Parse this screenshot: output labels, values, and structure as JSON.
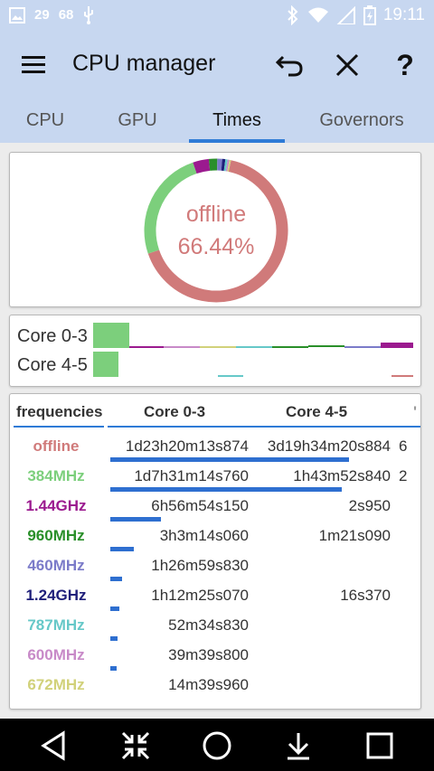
{
  "status_bar": {
    "left_icons": [
      "image-icon",
      "calendar-icon",
      "calendar-icon",
      "usb-icon"
    ],
    "left_texts": [
      "29",
      "68"
    ],
    "time": "19:11"
  },
  "app_bar": {
    "title": "CPU manager"
  },
  "tabs": [
    {
      "label": "CPU"
    },
    {
      "label": "GPU"
    },
    {
      "label": "Times",
      "active": true
    },
    {
      "label": "Governors"
    }
  ],
  "donut": {
    "center_label": "offline",
    "center_percent": "66.44%",
    "segments_pct": [
      66.44,
      25.0,
      3.6,
      1.9,
      1.1,
      0.7,
      0.5,
      0.4,
      0.36
    ],
    "segment_colors": [
      "#d07a7a",
      "#7ccf7c",
      "#9b1a8f",
      "#2a8f2a",
      "#7b7bc9",
      "#1f1f7a",
      "#66c8c8",
      "#c88ac8",
      "#d1d17a"
    ]
  },
  "core_bars": {
    "groups": [
      {
        "label": "Core 0-3"
      },
      {
        "label": "Core 4-5"
      }
    ]
  },
  "freq_table": {
    "headers": [
      "frequencies",
      "Core 0-3",
      "Core 4-5"
    ],
    "rows": [
      {
        "freq": "offline",
        "color": "#d07a7a",
        "core03": "1d23h20m13s874",
        "core45": "3d19h34m20s884",
        "overflow": "6",
        "bar_fraction": 0.66
      },
      {
        "freq": "384MHz",
        "color": "#7ccf7c",
        "core03": "1d7h31m14s760",
        "core45": "1h43m52s840",
        "overflow": "2",
        "bar_fraction": 0.64
      },
      {
        "freq": "1.44GHz",
        "color": "#9b1a8f",
        "core03": "6h56m54s150",
        "core45": "2s950",
        "overflow": "",
        "bar_fraction": 0.14
      },
      {
        "freq": "960MHz",
        "color": "#2a8f2a",
        "core03": "3h3m14s060",
        "core45": "1m21s090",
        "overflow": "",
        "bar_fraction": 0.065
      },
      {
        "freq": "460MHz",
        "color": "#7b7bc9",
        "core03": "1h26m59s830",
        "core45": "",
        "overflow": "",
        "bar_fraction": 0.032
      },
      {
        "freq": "1.24GHz",
        "color": "#1f1f7a",
        "core03": "1h12m25s070",
        "core45": "16s370",
        "overflow": "",
        "bar_fraction": 0.025
      },
      {
        "freq": "787MHz",
        "color": "#66c8c8",
        "core03": "52m34s830",
        "core45": "",
        "overflow": "",
        "bar_fraction": 0.02
      },
      {
        "freq": "600MHz",
        "color": "#c88ac8",
        "core03": "39m39s800",
        "core45": "",
        "overflow": "",
        "bar_fraction": 0.018
      },
      {
        "freq": "672MHz",
        "color": "#d1d17a",
        "core03": "14m39s960",
        "core45": "",
        "overflow": "",
        "bar_fraction": 0.0
      }
    ]
  },
  "nav_bar": {
    "icons": [
      "back-icon",
      "collapse-icon",
      "home-icon",
      "download-icon",
      "recents-icon"
    ]
  }
}
